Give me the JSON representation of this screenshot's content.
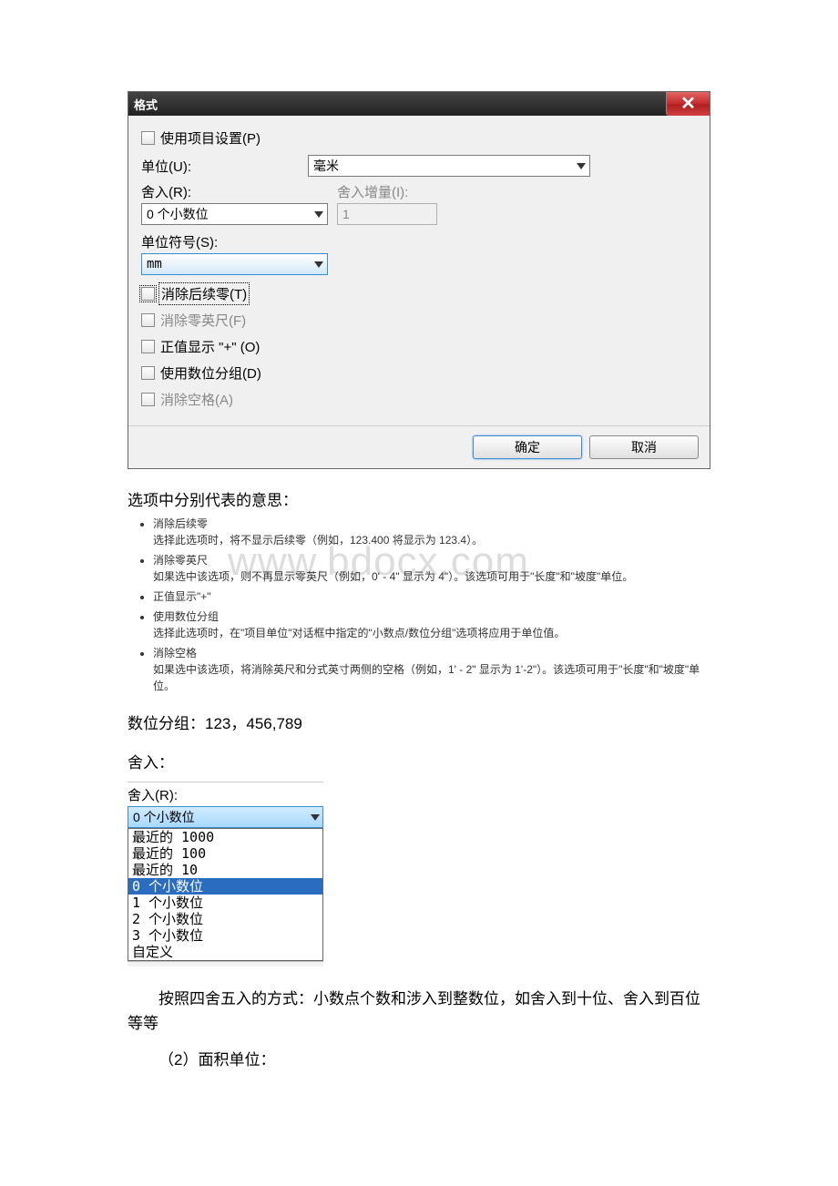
{
  "dialog": {
    "title": "格式",
    "use_project_settings": "使用项目设置(P)",
    "units_label": "单位(U):",
    "units_value": "毫米",
    "rounding_label": "舍入(R):",
    "rounding_value": "0 个小数位",
    "rounding_increment_label": "舍入增量(I):",
    "rounding_increment_value": "1",
    "unit_symbol_label": "单位符号(S):",
    "unit_symbol_value": "mm",
    "suppress_trailing_zeros": "消除后续零(T)",
    "suppress_zero_feet": "消除零英尺(F)",
    "show_plus": "正值显示 \"+\" (O)",
    "use_digit_grouping": "使用数位分组(D)",
    "suppress_spaces": "消除空格(A)",
    "ok": "确定",
    "cancel": "取消"
  },
  "explain": {
    "heading": "选项中分别代表的意思：",
    "watermark": "www.bdocx.com",
    "items": [
      {
        "title": "消除后续零",
        "desc": "选择此选项时，将不显示后续零（例如，123.400 将显示为 123.4）。"
      },
      {
        "title": "消除零英尺",
        "desc": "如果选中该选项，则不再显示零英尺（例如，0' - 4\" 显示为 4\"）。该选项可用于\"长度\"和\"坡度\"单位。"
      },
      {
        "title": "正值显示\"+\"",
        "desc": ""
      },
      {
        "title": "使用数位分组",
        "desc": "选择此选项时，在\"项目单位\"对话框中指定的\"小数点/数位分组\"选项将应用于单位值。"
      },
      {
        "title": "消除空格",
        "desc": "如果选中该选项，将消除英尺和分式英寸两侧的空格（例如，1' - 2\" 显示为 1'-2\"）。该选项可用于\"长度\"和\"坡度\"单位。"
      }
    ],
    "digit_grouping_line": "数位分组：123，456,789",
    "rounding_line": "舍入："
  },
  "dropdown": {
    "label": "舍入(R):",
    "current": "0 个小数位",
    "items": [
      "最近的 1000",
      "最近的 100",
      "最近的 10",
      "0 个小数位",
      "1 个小数位",
      "2 个小数位",
      "3 个小数位",
      "自定义"
    ],
    "selected_index": 3
  },
  "footer": {
    "para1": "按照四舍五入的方式：小数点个数和涉入到整数位，如舍入到十位、舍入到百位等等",
    "para2": "（2）面积单位："
  }
}
